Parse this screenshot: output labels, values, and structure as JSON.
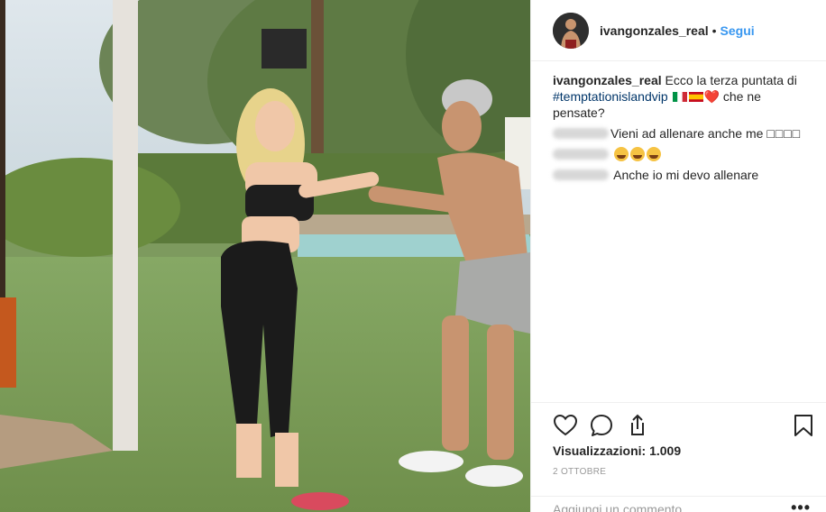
{
  "post": {
    "author": "ivangonzales_real",
    "separator": "•",
    "follow_label": "Segui"
  },
  "caption": {
    "username": "ivangonzales_real",
    "text_before": "Ecco la terza puntata di ",
    "hashtag": "#temptationislandvip",
    "text_after": " che ne pensate?",
    "flags": [
      "italy-flag",
      "spain-flag"
    ],
    "heart_glyph": "❤️"
  },
  "comments": [
    {
      "text": "Vieni ad allenare anche me",
      "trailing": "□□□□"
    },
    {
      "emojis": [
        "laughing-tears-emoji",
        "laughing-tears-emoji",
        "laughing-tears-emoji"
      ]
    },
    {
      "text": "Anche io mi devo allenare"
    }
  ],
  "actions": {
    "icons": [
      "heart-icon",
      "comment-icon",
      "share-icon",
      "bookmark-icon"
    ]
  },
  "stats": {
    "views_label": "Visualizzazioni: 1.009",
    "date": "2 OTTOBRE"
  },
  "composer": {
    "placeholder": "Aggiungi un commento...",
    "more_glyph": "•••"
  },
  "colors": {
    "link": "#3897f0",
    "hashtag": "#003569",
    "text": "#262626",
    "muted": "#999999",
    "border": "#efefef"
  }
}
